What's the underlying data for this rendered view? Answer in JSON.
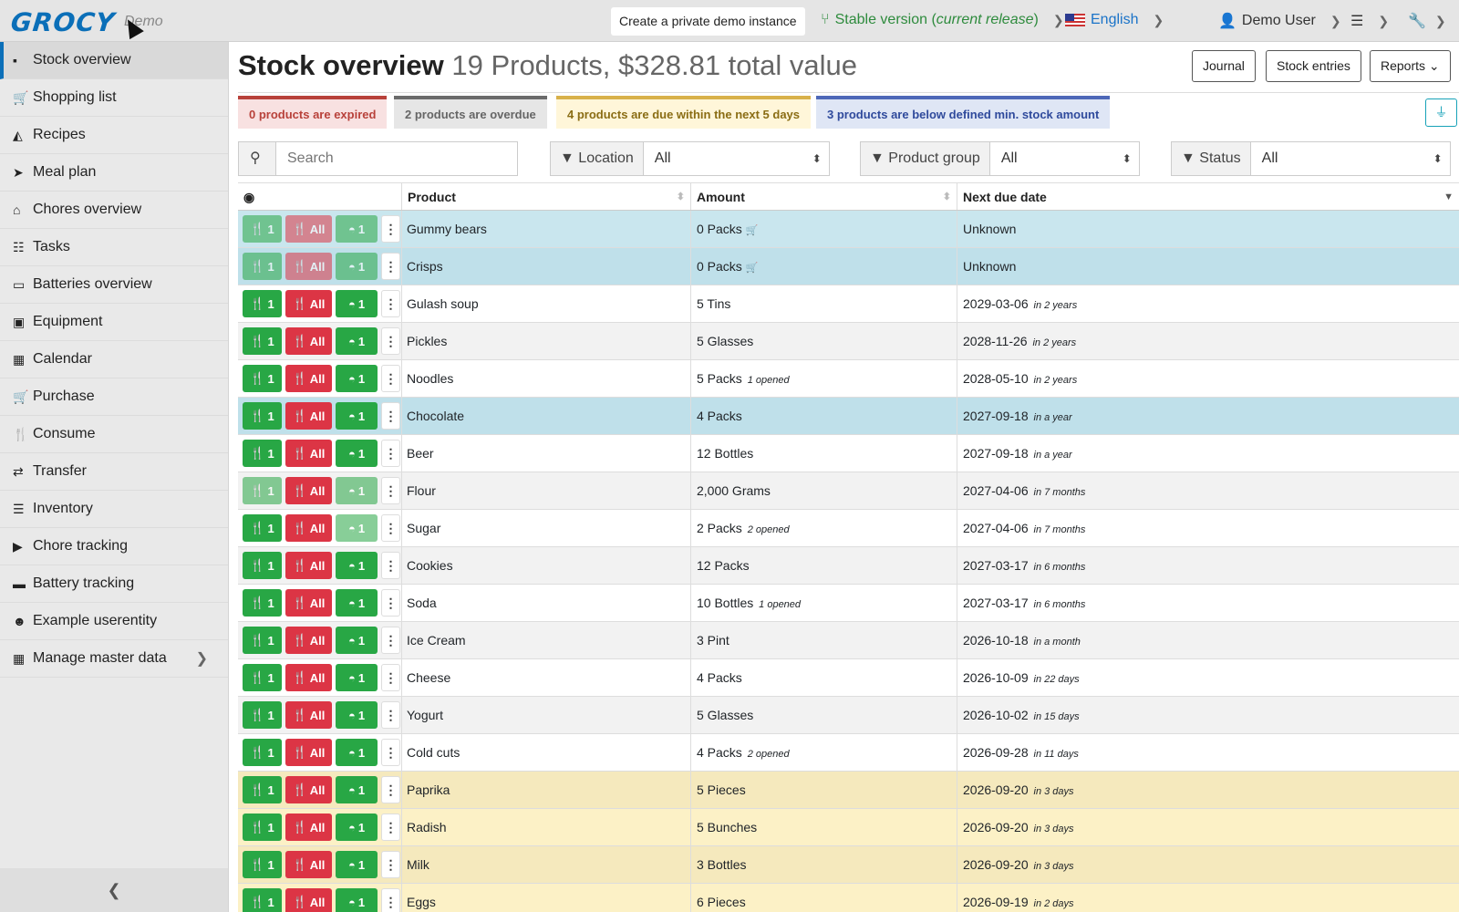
{
  "topbar": {
    "logo": "GROCY",
    "logo_sub": "Demo",
    "demo_button": "Create a private demo instance",
    "version_label": "Stable version (",
    "version_current": "current release",
    "version_close": ")",
    "language": "English",
    "user": "Demo User"
  },
  "sidebar": {
    "items": [
      {
        "label": "Stock overview",
        "icon": "box-icon"
      },
      {
        "label": "Shopping list",
        "icon": "cart-icon"
      },
      {
        "label": "Recipes",
        "icon": "pizza-icon"
      },
      {
        "label": "Meal plan",
        "icon": "paper-plane-icon"
      },
      {
        "label": "Chores overview",
        "icon": "home-icon"
      },
      {
        "label": "Tasks",
        "icon": "tasks-icon"
      },
      {
        "label": "Batteries overview",
        "icon": "battery-icon"
      },
      {
        "label": "Equipment",
        "icon": "toolbox-icon"
      },
      {
        "label": "Calendar",
        "icon": "calendar-icon"
      },
      {
        "label": "Purchase",
        "icon": "cart-plus-icon"
      },
      {
        "label": "Consume",
        "icon": "utensils-icon"
      },
      {
        "label": "Transfer",
        "icon": "exchange-icon"
      },
      {
        "label": "Inventory",
        "icon": "list-icon"
      },
      {
        "label": "Chore tracking",
        "icon": "play-icon"
      },
      {
        "label": "Battery tracking",
        "icon": "car-battery-icon"
      },
      {
        "label": "Example userentity",
        "icon": "smile-icon"
      },
      {
        "label": "Manage master data",
        "icon": "table-icon"
      }
    ]
  },
  "header": {
    "title": "Stock overview",
    "subtitle": "19 Products, $328.81 total value",
    "journal": "Journal",
    "stock_entries": "Stock entries",
    "reports": "Reports"
  },
  "badges": {
    "expired": "0 products are expired",
    "overdue": "2 products are overdue",
    "due": "4 products are due within the next 5 days",
    "min_stock": "3 products are below defined min. stock amount"
  },
  "filters": {
    "search_placeholder": "Search",
    "location_label": "Location",
    "location_value": "All",
    "group_label": "Product group",
    "group_value": "All",
    "status_label": "Status",
    "status_value": "All"
  },
  "table": {
    "columns": [
      "Product",
      "Amount",
      "Next due date"
    ],
    "rows": [
      {
        "product": "Gummy bears",
        "amount": "0 Packs",
        "opened": "",
        "due": "Unknown",
        "rel": ""
      },
      {
        "product": "Crisps",
        "amount": "0 Packs",
        "opened": "",
        "due": "Unknown",
        "rel": ""
      },
      {
        "product": "Gulash soup",
        "amount": "5 Tins",
        "opened": "",
        "due": "2029-03-06",
        "rel": "in 2 years"
      },
      {
        "product": "Pickles",
        "amount": "5 Glasses",
        "opened": "",
        "due": "2028-11-26",
        "rel": "in 2 years"
      },
      {
        "product": "Noodles",
        "amount": "5 Packs",
        "opened": "1 opened",
        "due": "2028-05-10",
        "rel": "in 2 years"
      },
      {
        "product": "Chocolate",
        "amount": "4 Packs",
        "opened": "",
        "due": "2027-09-18",
        "rel": "in a year"
      },
      {
        "product": "Beer",
        "amount": "12 Bottles",
        "opened": "",
        "due": "2027-09-18",
        "rel": "in a year"
      },
      {
        "product": "Flour",
        "amount": "2,000 Grams",
        "opened": "",
        "due": "2027-04-06",
        "rel": "in 7 months"
      },
      {
        "product": "Sugar",
        "amount": "2 Packs",
        "opened": "2 opened",
        "due": "2027-04-06",
        "rel": "in 7 months"
      },
      {
        "product": "Cookies",
        "amount": "12 Packs",
        "opened": "",
        "due": "2027-03-17",
        "rel": "in 6 months"
      },
      {
        "product": "Soda",
        "amount": "10 Bottles",
        "opened": "1 opened",
        "due": "2027-03-17",
        "rel": "in 6 months"
      },
      {
        "product": "Ice Cream",
        "amount": "3 Pint",
        "opened": "",
        "due": "2026-10-18",
        "rel": "in a month"
      },
      {
        "product": "Cheese",
        "amount": "4 Packs",
        "opened": "",
        "due": "2026-10-09",
        "rel": "in 22 days"
      },
      {
        "product": "Yogurt",
        "amount": "5 Glasses",
        "opened": "",
        "due": "2026-10-02",
        "rel": "in 15 days"
      },
      {
        "product": "Cold cuts",
        "amount": "4 Packs",
        "opened": "2 opened",
        "due": "2026-09-28",
        "rel": "in 11 days"
      },
      {
        "product": "Paprika",
        "amount": "5 Pieces",
        "opened": "",
        "due": "2026-09-20",
        "rel": "in 3 days"
      },
      {
        "product": "Radish",
        "amount": "5 Bunches",
        "opened": "",
        "due": "2026-09-20",
        "rel": "in 3 days"
      },
      {
        "product": "Milk",
        "amount": "3 Bottles",
        "opened": "",
        "due": "2026-09-20",
        "rel": "in 3 days"
      },
      {
        "product": "Eggs",
        "amount": "6 Pieces",
        "opened": "",
        "due": "2026-09-19",
        "rel": "in 2 days"
      }
    ],
    "action_labels": {
      "consume_one": "1",
      "consume_all": "All",
      "open_one": "1"
    }
  },
  "colors": {
    "accent": "#0b6fb8",
    "green": "#28a745",
    "red": "#dc3545"
  }
}
